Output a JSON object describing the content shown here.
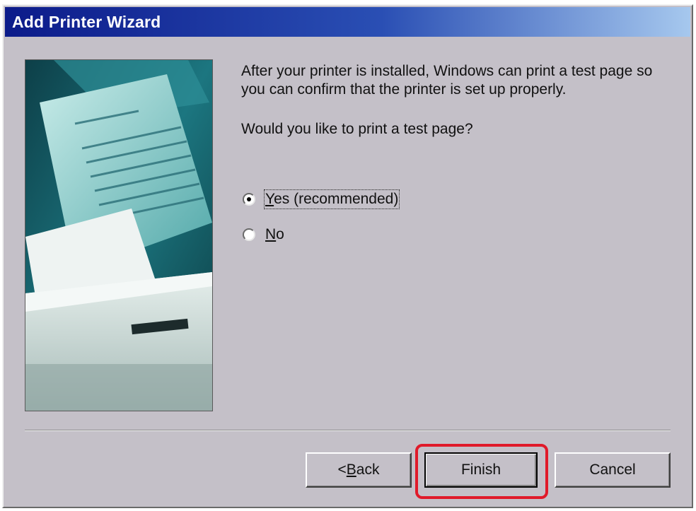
{
  "window": {
    "title": "Add Printer Wizard"
  },
  "main": {
    "description": "After your printer is installed, Windows can print a test page so you can confirm that the printer is set up properly.",
    "question": "Would you like to print a test page?",
    "options": [
      {
        "label_underlined": "Y",
        "label_rest": "es (recommended)",
        "selected": true
      },
      {
        "label_underlined": "N",
        "label_rest": "o",
        "selected": false
      }
    ]
  },
  "buttons": {
    "back_prefix": "< ",
    "back_underlined": "B",
    "back_rest": "ack",
    "finish": "Finish",
    "cancel": "Cancel"
  },
  "colors": {
    "dialog_bg": "#c4c0c8",
    "title_start": "#0c1b8a",
    "title_end": "#a6c8ee",
    "highlight": "#e01a2a"
  },
  "icons": {
    "artwork": "printer-illustration"
  }
}
